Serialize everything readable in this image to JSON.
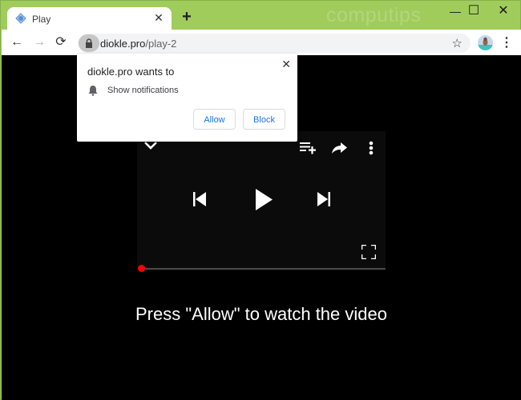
{
  "browser": {
    "tab": {
      "title": "Play",
      "favicon": "play-site-icon"
    },
    "new_tab_label": "+",
    "watermark": "computips",
    "window_controls": {
      "minimize": "—",
      "maximize": "☐",
      "close": "✕"
    },
    "toolbar": {
      "back": "←",
      "forward": "→",
      "reload": "⟳",
      "url_domain": "diokle.pro",
      "url_path": "/play-2",
      "bookmark_star": "☆",
      "menu": "⋮"
    }
  },
  "permission_popup": {
    "title": "diokle.pro wants to",
    "permission": "Show notifications",
    "close": "✕",
    "allow_label": "Allow",
    "block_label": "Block"
  },
  "player": {
    "progress": 0,
    "icons": [
      "chevron-down-icon",
      "playlist-add-icon",
      "share-icon",
      "more-vert-icon",
      "skip-previous-icon",
      "play-icon",
      "skip-next-icon",
      "fullscreen-icon"
    ]
  },
  "page": {
    "cta_text": "Press \"Allow\" to watch the video"
  },
  "colors": {
    "frame": "#a0cc5c",
    "link_blue": "#1a73e8",
    "progress_red": "#ff0000",
    "page_bg": "#000000"
  }
}
